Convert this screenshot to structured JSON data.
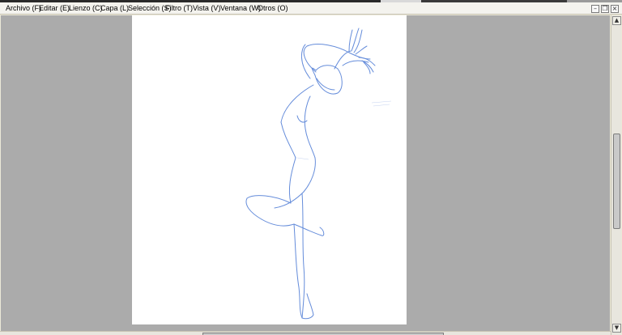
{
  "menu": {
    "items": [
      "Archivo (F)",
      "Editar (E)",
      "Lienzo (C)",
      "Capa (L)",
      "Selección (S)",
      "Filtro (T)",
      "Vista (V)",
      "Ventana (W)",
      "Otros (O)"
    ]
  },
  "window_controls": {
    "minimize_icon": "minimize-icon",
    "restore_icon": "restore-icon",
    "close_icon": "close-icon"
  },
  "canvas": {
    "background_color": "#ababab",
    "paper_color": "#ffffff",
    "sketch_color": "#4a78d4"
  }
}
